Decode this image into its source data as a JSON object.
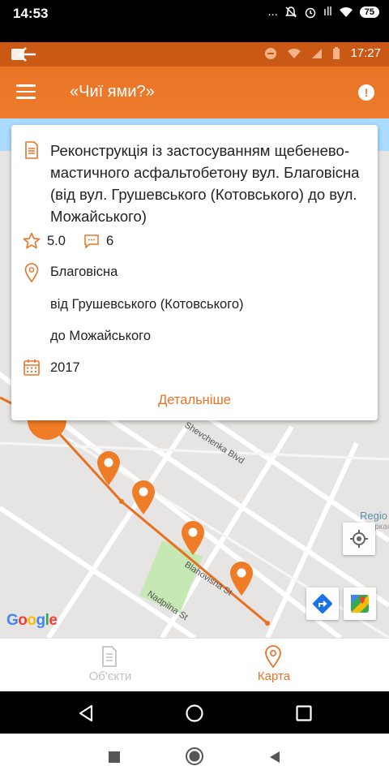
{
  "outer_status": {
    "time": "14:53",
    "battery": "75",
    "more": "...",
    "signal": "ıll"
  },
  "inner_status": {
    "time": "17:27"
  },
  "appbar": {
    "title": "«Чиї ями?»",
    "alert": "!"
  },
  "card": {
    "title": "Реконструкція із застосуванням щебенево-мастичного асфальтобетону вул. Благовісна (від вул. Грушевського (Котовського) до вул. Можайського)",
    "rating": "5.0",
    "comments": "6",
    "address_line1": "Благовісна",
    "address_line2": "від Грушевського (Котовського)",
    "address_line3": "до Можайського",
    "year": "2017",
    "more_link": "Детальніше"
  },
  "map": {
    "labels": {
      "street1": "Shevchenka Blvd",
      "street2": "Blahovisna St",
      "street3": "Nadpilna St",
      "poi": "Regio",
      "poi_sub": "Черкась"
    },
    "google": [
      "G",
      "o",
      "o",
      "g",
      "l",
      "e"
    ],
    "route_color": "#e8701f",
    "pin_color": "#ef7d27"
  },
  "bottom_nav": {
    "tabs": [
      {
        "label": "Об'єкти",
        "icon": "document-icon",
        "active": false
      },
      {
        "label": "Карта",
        "icon": "map-pin-icon",
        "active": true
      }
    ]
  },
  "colors": {
    "accent": "#ea7326",
    "statusbar": "#c95915"
  }
}
